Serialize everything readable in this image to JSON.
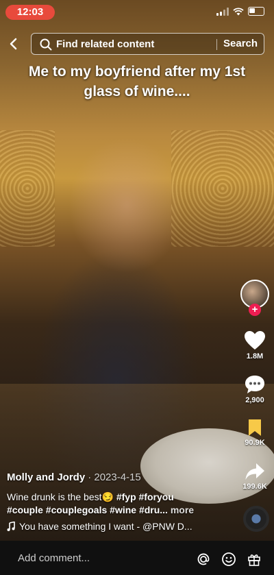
{
  "status_bar": {
    "time": "12:03"
  },
  "search": {
    "placeholder": "Find related content",
    "button_label": "Search"
  },
  "video": {
    "caption": "Me to my boyfriend after my 1st glass of wine...."
  },
  "actions": {
    "likes": "1.8M",
    "comments": "2,900",
    "saves": "90.9K",
    "shares": "199.6K",
    "follow_label": "+"
  },
  "post": {
    "author": "Molly and Jordy",
    "date": "· 2023-4-15",
    "description_text": "Wine drunk is the best😏 ",
    "hashtags_line1": "#fyp #foryou",
    "hashtags_line2": "#couple #couplegoals #wine #dru...",
    "more_label": " more",
    "sound": "You have something I want - @PNW D..."
  },
  "comment_bar": {
    "placeholder": "Add comment..."
  },
  "colors": {
    "time_pill": "#e84a3c",
    "follow": "#ee1d52",
    "save": "#f7c948"
  },
  "icons": [
    "back-icon",
    "search-icon",
    "heart-icon",
    "comment-icon",
    "bookmark-icon",
    "share-icon",
    "music-note-icon",
    "at-icon",
    "emoji-icon",
    "gift-icon"
  ]
}
